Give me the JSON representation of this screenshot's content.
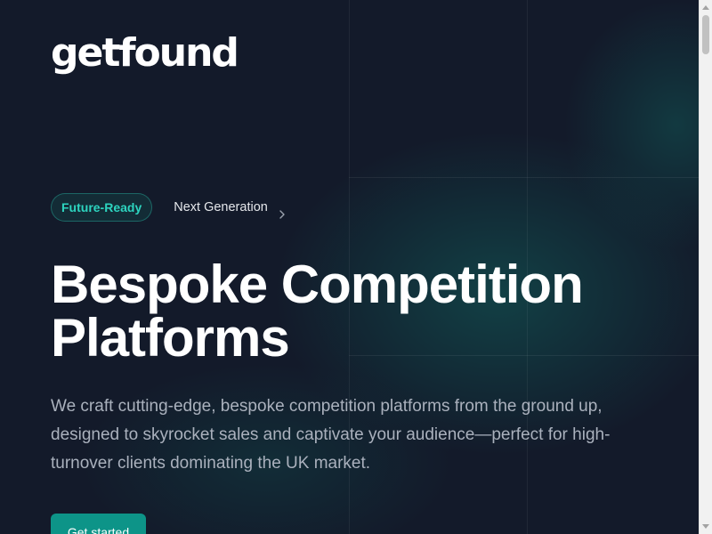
{
  "brand": {
    "logo_text": "getfound"
  },
  "hero": {
    "badge": "Future-Ready",
    "announcement_link": "Next Generation",
    "title_line1": "Bespoke Competition",
    "title_line2": "Platforms",
    "description": "We craft cutting-edge, bespoke competition platforms from the ground up, designed to skyrocket sales and captivate your audience—perfect for high-turnover clients dominating the UK market.",
    "cta_label": "Get started"
  },
  "icons": {
    "announcement_arrow": "chevron-right-icon"
  },
  "colors": {
    "background": "#131a2a",
    "accent": "#2dd4bf",
    "button": "#0d9488",
    "heading": "#ffffff",
    "body_text": "#aab1bd"
  },
  "scrollbar": {
    "position_fraction": 0.0
  }
}
